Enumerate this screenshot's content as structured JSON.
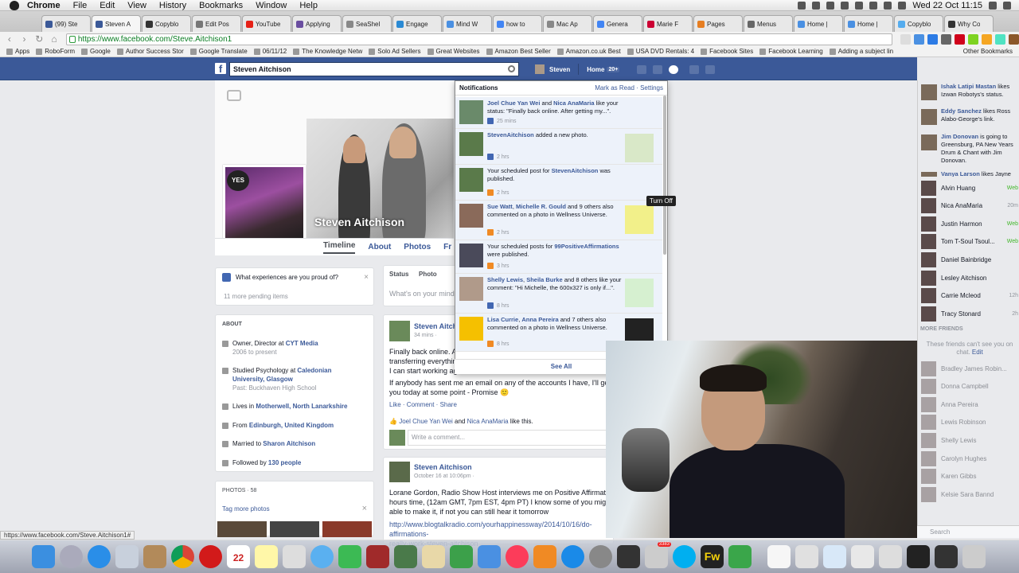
{
  "menubar": {
    "app": "Chrome",
    "items": [
      "File",
      "Edit",
      "View",
      "History",
      "Bookmarks",
      "Window",
      "Help"
    ],
    "clock": "Wed 22 Oct  11:15"
  },
  "tabs": [
    {
      "title": "(99) Ste",
      "color": "#3b5998"
    },
    {
      "title": "Steven A",
      "color": "#3b5998",
      "active": true
    },
    {
      "title": "Copyblo",
      "color": "#333333"
    },
    {
      "title": "Edit Pos",
      "color": "#777777"
    },
    {
      "title": "YouTube",
      "color": "#e62117"
    },
    {
      "title": "Applying",
      "color": "#6a4ea0"
    },
    {
      "title": "SeaShel",
      "color": "#888888"
    },
    {
      "title": "Engage",
      "color": "#2a8ad4"
    },
    {
      "title": "Mind W",
      "color": "#4a90e2"
    },
    {
      "title": "how to",
      "color": "#4285f4"
    },
    {
      "title": "Mac Ap",
      "color": "#888888"
    },
    {
      "title": "Genera",
      "color": "#4285f4"
    },
    {
      "title": "Marie F",
      "color": "#c03"
    },
    {
      "title": "Pages",
      "color": "#e67e22"
    },
    {
      "title": "Menus",
      "color": "#666666"
    },
    {
      "title": "Home |",
      "color": "#4a90e2"
    },
    {
      "title": "Home |",
      "color": "#4a90e2"
    },
    {
      "title": "Copyblo",
      "color": "#55acee"
    },
    {
      "title": "Why Co",
      "color": "#333333"
    }
  ],
  "address": {
    "url": "https://www.facebook.com/Steve.Aitchison1"
  },
  "bookmarks": [
    "Apps",
    "RoboForm",
    "Google",
    "Author Success Stor",
    "Google Translate",
    "06/11/12",
    "The Knowledge Netw",
    "Solo Ad Sellers",
    "Great Websites",
    "Amazon Best Seller",
    "Amazon.co.uk Best",
    "USA DVD Rentals: 4",
    "Facebook Sites",
    "Facebook Learning",
    "Adding a subject lin"
  ],
  "bookmarks_other": "Other Bookmarks",
  "fb": {
    "search_value": "Steven Aitchison",
    "user": "Steven",
    "home": "Home",
    "home_count": "20+"
  },
  "profile": {
    "name": "Steven Aitchison",
    "tabs": [
      "Timeline",
      "About",
      "Photos",
      "Fr"
    ]
  },
  "left": {
    "question": "What experiences are you proud of?",
    "pending": "11 more pending items",
    "about_title": "ABOUT",
    "about": [
      {
        "main": "Owner, Director at ",
        "link": "CYT Media",
        "sub": "2006 to present"
      },
      {
        "main": "Studied Psychology at ",
        "link": "Caledonian University, Glasgow",
        "sub": "Past: Buckhaven High School"
      },
      {
        "main": "Lives in ",
        "link": "Motherwell, North Lanarkshire",
        "sub": ""
      },
      {
        "main": "From ",
        "link": "Edinburgh, United Kingdom",
        "sub": ""
      },
      {
        "main": "Married to ",
        "link": "Sharon Aitchison",
        "sub": ""
      },
      {
        "main": "Followed by ",
        "link": "130 people",
        "sub": ""
      }
    ],
    "photos_title": "PHOTOS · 58",
    "tag_more": "Tag more photos"
  },
  "composer": {
    "status": "Status",
    "photo": "Photo",
    "placeholder": "What's on your mind?"
  },
  "post1": {
    "name": "Steven Aitch",
    "time": "34 mins ·",
    "text": "Finally back online. A\ntransferring everythin\nI can start working ag",
    "text2": "If anybody has sent me an email on any of the accounts I have, I'll get\nyou today at some point - Promise 🙂",
    "actions": "Like · Comment · Share",
    "likes_a": "Joel Chue Yan Wei",
    "likes_and": " and ",
    "likes_b": "Nica AnaMaria",
    "likes_end": " like this.",
    "comment_placeholder": "Write a comment..."
  },
  "post2": {
    "name": "Steven Aitchison",
    "time": "October 16 at 10:06pm ·",
    "text": "Lorane Gordon, Radio Show Host interviews me on Positive Affirmatio\nhours time, (12am GMT, 7pm EST, 4pm PT) I know some of you migh\nable to make it, if not you can still hear it tomorrow",
    "link": "http://www.blogtalkradio.com/yourhappinessway/2014/10/16/do-affirmations-\nreally-work-steven-aitchison"
  },
  "notifications": {
    "title": "Notifications",
    "mark_read": "Mark as Read",
    "settings": "Settings",
    "see_all": "See All",
    "tooltip": "Turn Off",
    "items": [
      {
        "bold": "Joel Chue Yan Wei",
        "mid": " and ",
        "bold2": "Nica AnaMaria",
        "rest": " like your status: \"Finally back online. After getting my...\".",
        "time": "25 mins",
        "icon_color": "#4267b2",
        "thumb": ""
      },
      {
        "bold": "StevenAitchison",
        "mid": " added a new photo.",
        "bold2": "",
        "rest": "",
        "time": "2 hrs",
        "icon_color": "#4267b2",
        "thumb": "#d9e8c8"
      },
      {
        "bold": "",
        "mid": "Your scheduled post for ",
        "bold2": "StevenAitchison",
        "rest": " was published.",
        "time": "2 hrs",
        "icon_color": "#f08a24",
        "thumb": ""
      },
      {
        "bold": "Sue Watt",
        "mid": ", ",
        "bold2": "Michelle R. Gould",
        "rest": " and 9 others also commented on a photo in Wellness Universe.",
        "time": "2 hrs",
        "icon_color": "#f08a24",
        "thumb": "#f2f08a"
      },
      {
        "bold": "",
        "mid": "Your scheduled posts for ",
        "bold2": "99PositiveAffirmations",
        "rest": " were published.",
        "time": "3 hrs",
        "icon_color": "#f08a24",
        "thumb": ""
      },
      {
        "bold": "Shelly Lewis",
        "mid": ", ",
        "bold2": "Sheila Burke",
        "rest": " and 8 others like your comment: \"Hi Michelle, the 600x327 is only if...\".",
        "time": "8 hrs",
        "icon_color": "#4267b2",
        "thumb": "#d6f0d0"
      },
      {
        "bold": "Lisa Currie",
        "mid": ", ",
        "bold2": "Anna Pereira",
        "rest": " and 7 others also commented on a photo in Wellness Universe.",
        "time": "8 hrs",
        "icon_color": "#f08a24",
        "thumb": "#222222"
      }
    ]
  },
  "chat": {
    "ticker": [
      {
        "bold": "Ishak Latipi Mastan",
        "rest": " likes Izwan Robotys's status."
      },
      {
        "bold": "Eddy Sanchez",
        "rest": " likes Ross Alabo-George's link."
      },
      {
        "bold": "Jim Donovan",
        "rest": " is going to Greensburg, PA New Years Drum & Chant with Jim Donovan."
      },
      {
        "bold": "Vanya Larson",
        "rest": " likes Jayne"
      }
    ],
    "online": [
      {
        "name": "Alvin Huang",
        "status": "Web"
      },
      {
        "name": "Nica AnaMaria",
        "status": "20m"
      },
      {
        "name": "Justin Harmon",
        "status": "Web"
      },
      {
        "name": "Tom T-Soul Tsoul...",
        "status": "Web"
      },
      {
        "name": "Daniel Bainbridge",
        "status": ""
      },
      {
        "name": "Lesley Aitchison",
        "status": ""
      },
      {
        "name": "Carrie Mcleod",
        "status": "12h"
      },
      {
        "name": "Tracy Stonard",
        "status": "2h"
      }
    ],
    "more_friends": "MORE FRIENDS",
    "note": "These friends can't see you on chat.",
    "note_link": "Edit",
    "offline": [
      "Bradley James Robin...",
      "Donna Campbell",
      "Anna Pereira",
      "Lewis Robinson",
      "Shelly Lewis",
      "Carolyn Hughes",
      "Karen Gibbs",
      "Kelsie Sara Bannd"
    ],
    "search": "Search"
  },
  "status_url": "https://www.facebook.com/Steve.Aitchison1#",
  "dock": {
    "calendar_day": "22",
    "mail_badge": "3383",
    "fw_label": "Fw"
  }
}
